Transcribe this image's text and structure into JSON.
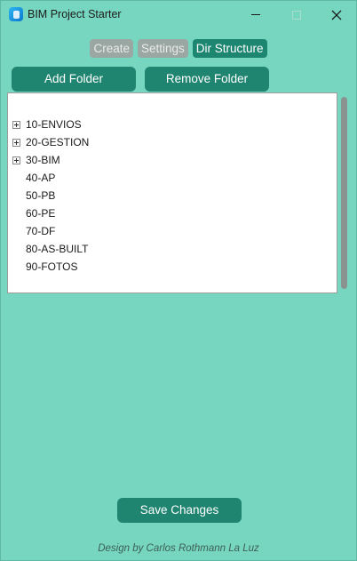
{
  "window": {
    "title": "BIM Project Starter"
  },
  "tabs": [
    {
      "label": "Create",
      "active": false
    },
    {
      "label": "Settings",
      "active": false
    },
    {
      "label": "Dir Structure",
      "active": true
    }
  ],
  "toolbar": {
    "add_label": "Add Folder",
    "remove_label": "Remove Folder"
  },
  "tree": {
    "items": [
      {
        "label": "10-ENVIOS",
        "expandable": true
      },
      {
        "label": "20-GESTION",
        "expandable": true
      },
      {
        "label": "30-BIM",
        "expandable": true
      },
      {
        "label": "40-AP",
        "expandable": false
      },
      {
        "label": "50-PB",
        "expandable": false
      },
      {
        "label": "60-PE",
        "expandable": false
      },
      {
        "label": "70-DF",
        "expandable": false
      },
      {
        "label": "80-AS-BUILT",
        "expandable": false
      },
      {
        "label": "90-FOTOS",
        "expandable": false
      }
    ]
  },
  "actions": {
    "save_label": "Save Changes"
  },
  "footer": {
    "credit": "Design by Carlos Rothmann La Luz"
  },
  "colors": {
    "background": "#77d6c0",
    "button": "#1f8470",
    "active_tab": "#1d8670",
    "inactive_tab": "#9aa7a3"
  }
}
